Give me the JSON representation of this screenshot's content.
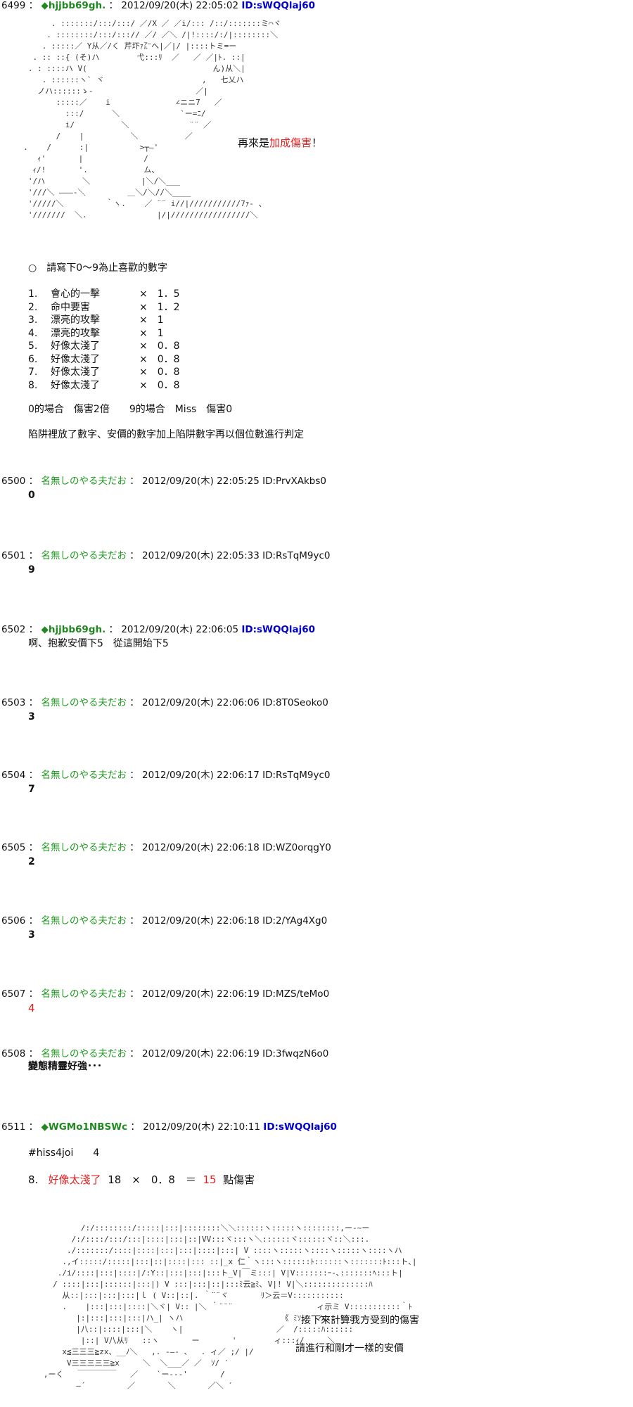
{
  "posts": [
    {
      "num": "6499",
      "name": "◆hjjbb69gh.",
      "date": "2012/09/20(木) 22:05:02",
      "id": "ID:sWQQlaj60"
    },
    {
      "num": "6500",
      "name": "名無しのやる夫だお",
      "date": "2012/09/20(木) 22:05:25",
      "id": "ID:PrvXAkbs0",
      "text": "0"
    },
    {
      "num": "6501",
      "name": "名無しのやる夫だお",
      "date": "2012/09/20(木) 22:05:33",
      "id": "ID:RsTqM9yc0",
      "text": "9"
    },
    {
      "num": "6502",
      "name": "◆hjjbb69gh.",
      "date": "2012/09/20(木) 22:06:05",
      "id": "ID:sWQQlaj60",
      "text": "啊、抱歉安價下5　從這開始下5"
    },
    {
      "num": "6503",
      "name": "名無しのやる夫だお",
      "date": "2012/09/20(木) 22:06:06",
      "id": "ID:8T0Seoko0",
      "text": "3"
    },
    {
      "num": "6504",
      "name": "名無しのやる夫だお",
      "date": "2012/09/20(木) 22:06:17",
      "id": "ID:RsTqM9yc0",
      "text": "7"
    },
    {
      "num": "6505",
      "name": "名無しのやる夫だお",
      "date": "2012/09/20(木) 22:06:18",
      "id": "ID:WZ0orqgY0",
      "text": "2"
    },
    {
      "num": "6506",
      "name": "名無しのやる夫だお",
      "date": "2012/09/20(木) 22:06:18",
      "id": "ID:2/YAg4Xg0",
      "text": "3"
    },
    {
      "num": "6507",
      "name": "名無しのやる夫だお",
      "date": "2012/09/20(木) 22:06:19",
      "id": "ID:MZS/teMo0",
      "text": "4"
    },
    {
      "num": "6508",
      "name": "名無しのやる夫だお",
      "date": "2012/09/20(木) 22:06:19",
      "id": "ID:3fwqzN6o0",
      "text": "變態精靈好強･･･"
    },
    {
      "num": "6511",
      "name": "◆WGMo1NBSWc",
      "date": "2012/09/20(木) 22:10:11",
      "id": "ID:sWQQlaj60"
    }
  ],
  "p6499": {
    "aa": "        . :::::::/:::/:::/ ／/X ／ ／i/::: /::/:::::::ミ⌒ヾ\n       . ::::::::/:::/:::// ／/ ／＼ /|!::::/:/|::::::::＼\n      . :::::／ Y从／/く 芹圷ｧ㌃へ|／|/ |::::トミ=ー\n    . :: ::{ (そ)ハ        弋:::ﾘ  ／   ／ ／|ﾄ. ::|\n   . : ::::ハ V(                           ん)从＼|\n      . ::::::ヽ` ヾ                     ,   七乂ハ\n     ノハ::::::ゝ-                      ／|\n         :::::／    i              ∠ニニ7   ／\n           :::/      ＼             `ー=ﾆ/\n           i/          ＼             ¨¨ ／\n         /    |          ＼          ／\n  .    /      :|           >┬―'\n     ｨ'       |             /\n    ｨ/!       '.            ム、\n   '/ハ        ＼           |＼/＼___\n   '///＼ ―――‐＼         ＿＼/＼//＼____\n   '/////＼         ｀ヽ.    ／ ¨¨ i//|///////////7ｧ- 、\n   '///////  ＼.               |/|/////////////////＼",
    "caption_pre": "再來是",
    "caption_red": "加成傷害",
    "caption_post": "！",
    "prompt": "○　請寫下0～9為止喜歡的數字",
    "items": [
      {
        "no": "1.",
        "name": "會心的一擊",
        "mult": "×　1．5"
      },
      {
        "no": "2.",
        "name": "命中要害",
        "mult": "×　1．2"
      },
      {
        "no": "3.",
        "name": "漂亮的攻擊",
        "mult": "×　1"
      },
      {
        "no": "4.",
        "name": "漂亮的攻擊",
        "mult": "×　1"
      },
      {
        "no": "5.",
        "name": "好像太淺了",
        "mult": "×　0．8"
      },
      {
        "no": "6.",
        "name": "好像太淺了",
        "mult": "×　0．8"
      },
      {
        "no": "7.",
        "name": "好像太淺了",
        "mult": "×　0．8"
      },
      {
        "no": "8.",
        "name": "好像太淺了",
        "mult": "×　0．8"
      }
    ],
    "note1": "0的場合　傷害2倍　　9的場合　Miss　傷害0",
    "note2": "陷阱裡放了數字、安價的數字加上陷阱數字再以個位數進行判定"
  },
  "p6511": {
    "hash": "#hiss4joi　　4",
    "calc_no": "8.",
    "calc_name": "好像太淺了",
    "calc_expr": "18　×　0．8　＝",
    "calc_result": "15",
    "calc_unit": "點傷害",
    "aa": "           /:/::::::::/:::::|:::|::::::::＼＼::::::ヽ:::::ヽ::::::::,ー‐~ー\n         /:/::::/:::/:::|::::|:::|::|VV:::ヾ:::ヽ＼::::::ヾ::::::ヾ::＼:::.\n        ./:::::::/::::|::::|:::|:::|::::|:::| V ::::ヽ:::::ヽ::::ヽ:::::ヽ::::ヽハ\n       .,イ:::::/:::::|:::|::|::::|::: ::|_x 仁｀ヽ:::ヽ::::::ﾄ::::::ヽ:::::::ﾄ:::ト､|\n      ./i/::::|:::|::::|/:Y::|:::|:::|:::ト_V|￣ミ:::| V|V:::::::ｰ-､:::::::ﾍ:::ト|\n     / ::::|:::|::::::|:::|) V :::|:::|::|:::ﾐ云≧ﾐ､ V|! V|＼::::::::::::::ﾊ\n       从::|:::|:::|:::|ｌ ( V::|::|. ｀¨¨ヾ       ﾘ＞云＝V:::::::::::\n       .    |:::|:::|::::|＼ヾ| V:: |＼ ｀¨¨¨                  ィ示ミ V:::::::::::｀ﾄ\n          |:|:::|:::|:::|ハ_| ヽハ                     《 ﾐｿノ  ヘ:::ﾄ::ﾊ\n          |八::|::::|:::|＼    ヽ|                    ／  /:::::ﾊ::::::\n           |::| V八从ﾘ   ::ヽ       ー       '        ィ:::ｨ/     ＼\n       x≦三三三≧zx、__ﾉ＼   ,. -―- 、  . ィ／ ;/ |/\n        V三三三三三≧x     ＼  ＼___／ ／  ｿ/ ′\n   ,ーく   ￣￣￣￣￣   ／    `ー---'       /\n          ―´         ／       ＼       ／＼ ′",
    "caption1": "接下來計算我方受到的傷害",
    "caption2": "請進行和剛才一樣的安價"
  }
}
